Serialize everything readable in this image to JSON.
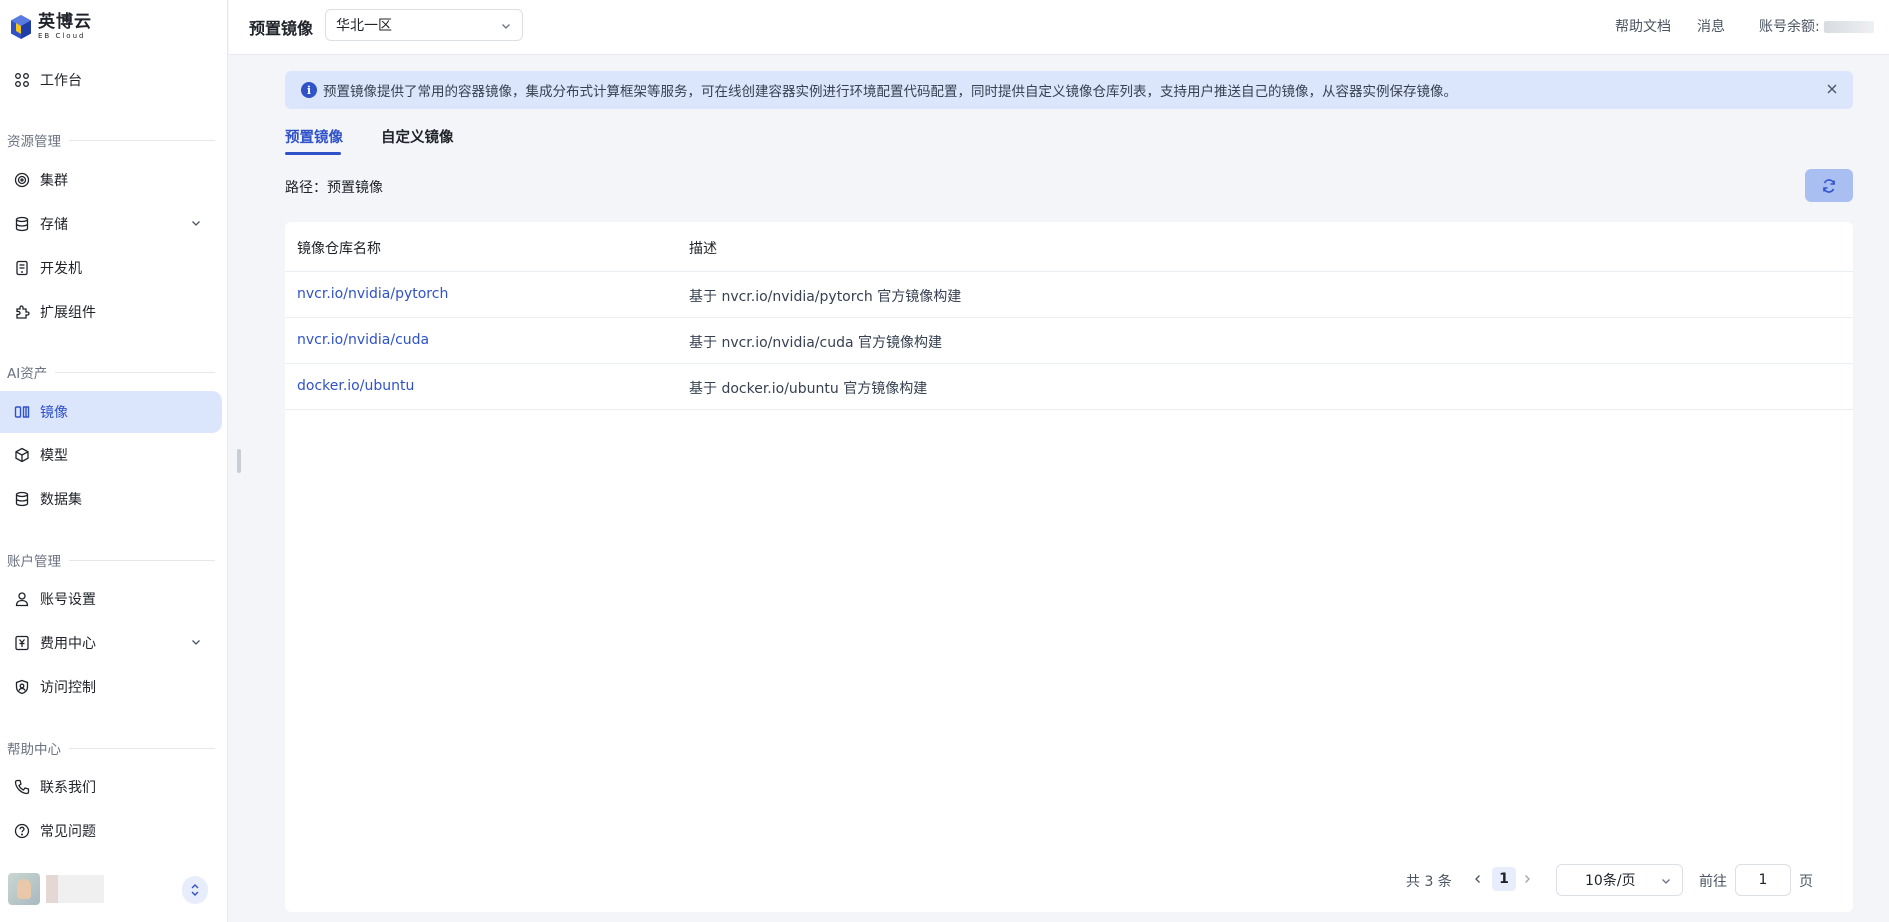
{
  "brand": {
    "name_cn": "英博云",
    "name_en": "EB Cloud"
  },
  "sidebar": {
    "workbench": "工作台",
    "sections": {
      "resources": "资源管理",
      "ai_assets": "AI资产",
      "account": "账户管理",
      "help": "帮助中心"
    },
    "items": {
      "cluster": "集群",
      "storage": "存储",
      "devbox": "开发机",
      "extensions": "扩展组件",
      "images": "镜像",
      "models": "模型",
      "datasets": "数据集",
      "account_settings": "账号设置",
      "billing": "费用中心",
      "access_control": "访问控制",
      "contact": "联系我们",
      "faq": "常见问题"
    },
    "active": "images"
  },
  "header": {
    "title": "预置镜像",
    "region": "华北一区",
    "help_docs": "帮助文档",
    "messages": "消息",
    "balance_label": "账号余额:"
  },
  "alert": {
    "text": "预置镜像提供了常用的容器镜像，集成分布式计算框架等服务，可在线创建容器实例进行环境配置代码配置，同时提供自定义镜像仓库列表，支持用户推送自己的镜像，从容器实例保存镜像。"
  },
  "tabs": [
    {
      "label": "预置镜像",
      "active": true
    },
    {
      "label": "自定义镜像",
      "active": false
    }
  ],
  "path": "路径：预置镜像",
  "table": {
    "columns": [
      "镜像仓库名称",
      "描述"
    ],
    "rows": [
      {
        "name": "nvcr.io/nvidia/pytorch",
        "desc": "基于 nvcr.io/nvidia/pytorch 官方镜像构建"
      },
      {
        "name": "nvcr.io/nvidia/cuda",
        "desc": "基于 nvcr.io/nvidia/cuda 官方镜像构建"
      },
      {
        "name": "docker.io/ubuntu",
        "desc": "基于 docker.io/ubuntu 官方镜像构建"
      }
    ]
  },
  "pagination": {
    "total": "共 3 条",
    "current_page": "1",
    "page_size": "10条/页",
    "goto_label": "前往",
    "goto_value": "1",
    "page_suffix": "页"
  },
  "colors": {
    "accent": "#2f52c9",
    "accent_light": "#dbe5fb"
  }
}
